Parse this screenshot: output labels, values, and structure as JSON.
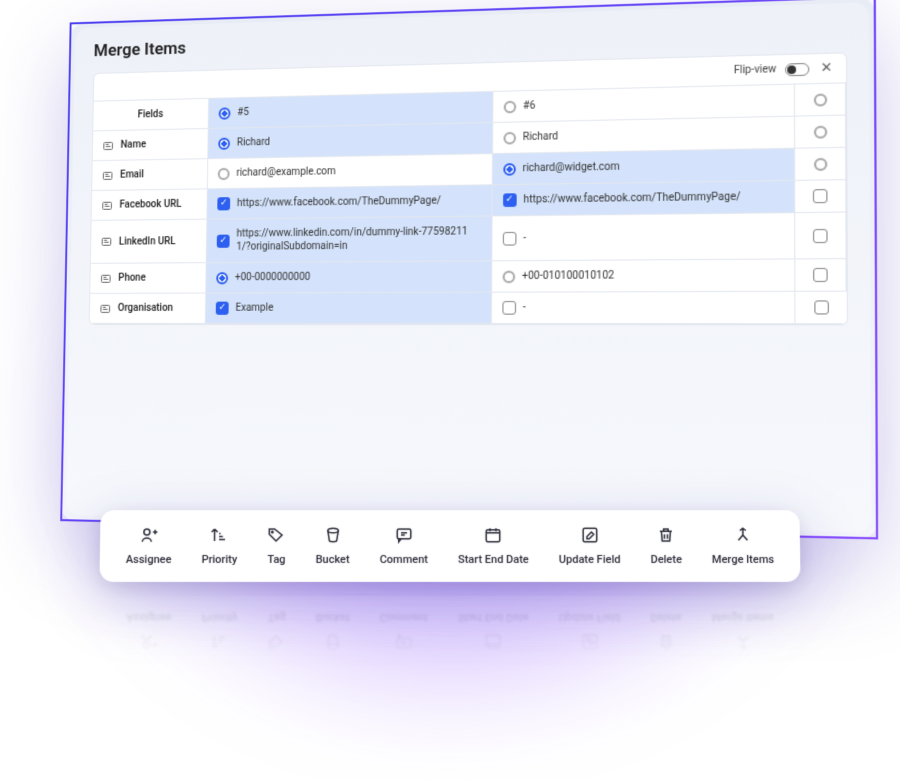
{
  "header": {
    "title": "Merge Items"
  },
  "flipview": {
    "label": "Flip-view"
  },
  "columns": {
    "fields_header": "Fields",
    "col_a": "#5",
    "col_b": "#6"
  },
  "rows": [
    {
      "field": "Name",
      "icon": "text-icon",
      "a": "Richard",
      "a_sel": true,
      "a_type": "radio",
      "b": "Richard",
      "b_sel": false,
      "b_type": "radio",
      "c_type": "radio"
    },
    {
      "field": "Email",
      "icon": "text-icon",
      "a": "richard@example.com",
      "a_sel": false,
      "a_type": "radio",
      "b": "richard@widget.com",
      "b_sel": true,
      "b_type": "radio",
      "c_type": "radio"
    },
    {
      "field": "Facebook URL",
      "icon": "text-icon",
      "a": "https://www.facebook.com/TheDummyPage/",
      "a_sel": true,
      "a_type": "check",
      "b": "https://www.facebook.com/TheDummyPage/",
      "b_sel": true,
      "b_type": "check",
      "c_type": "check"
    },
    {
      "field": "LinkedIn URL",
      "icon": "text-icon",
      "a": "https://www.linkedin.com/in/dummy-link-775982111/?originalSubdomain=in",
      "a_sel": true,
      "a_type": "check",
      "b": "-",
      "b_sel": false,
      "b_type": "check",
      "c_type": "check"
    },
    {
      "field": "Phone",
      "icon": "text-icon",
      "a": "+00-0000000000",
      "a_sel": true,
      "a_type": "radio",
      "b": "+00-010100010102",
      "b_sel": false,
      "b_type": "radio",
      "c_type": "check"
    },
    {
      "field": "Organisation",
      "icon": "text-icon",
      "a": "Example",
      "a_sel": true,
      "a_type": "check",
      "b": "-",
      "b_sel": false,
      "b_type": "check",
      "c_type": "check"
    }
  ],
  "toolbar": [
    {
      "label": "Assignee",
      "icon": "user-plus-icon"
    },
    {
      "label": "Priority",
      "icon": "priority-icon"
    },
    {
      "label": "Tag",
      "icon": "tag-icon"
    },
    {
      "label": "Bucket",
      "icon": "bucket-icon"
    },
    {
      "label": "Comment",
      "icon": "comment-icon"
    },
    {
      "label": "Start End Date",
      "icon": "calendar-icon"
    },
    {
      "label": "Update Field",
      "icon": "edit-icon"
    },
    {
      "label": "Delete",
      "icon": "trash-icon"
    },
    {
      "label": "Merge Items",
      "icon": "merge-icon"
    }
  ]
}
